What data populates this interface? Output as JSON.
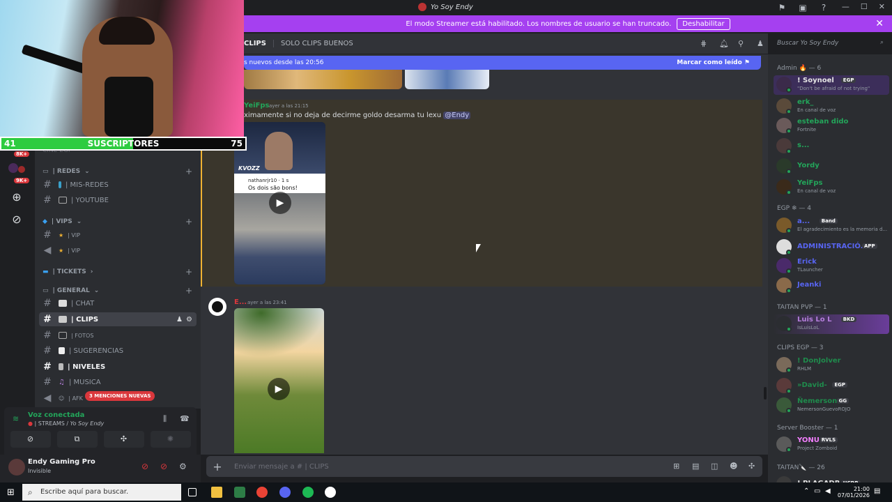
{
  "app": {
    "title": "Yo Soy Endy"
  },
  "banner": {
    "text": "El modo Streamer está habilitado. Los nombres de usuario se han truncado.",
    "button": "Deshabilitar"
  },
  "overlay": {
    "sub_low": "41",
    "sub_label": "SUSCRIPTORES",
    "sub_high": "75",
    "progress_fraction": 0.54
  },
  "rail": {
    "badges": [
      "8K+",
      "9K+"
    ]
  },
  "channels": {
    "partial_top": "CINE EGP",
    "categories": {
      "redes": "| REDES",
      "vips": "| VIPS",
      "tickets": "| TICKETS",
      "general": "| GENERAL"
    },
    "items": {
      "mis_redes": "| MIS-REDES",
      "youtube": "| YOUTUBE",
      "vip1": "| VIP",
      "vip2": "| VIP",
      "chat": "| CHAT",
      "clips": "| CLIPS",
      "fotos": "| FOTOS",
      "sugerencias": "| SUGERENCIAS",
      "niveles": "| NIVELES",
      "musica": "| MUSICA",
      "afk": "| AFK"
    },
    "mentions": "3 MENCIONES NUEVAS"
  },
  "voice": {
    "title": "Voz conectada",
    "channel_prefix": "| STREAMS /",
    "server": "Yo Soy Endy"
  },
  "user": {
    "name": "Endy Gaming Pro",
    "status": "Invisible"
  },
  "header": {
    "channel": "CLIPS",
    "topic": "SOLO CLIPS BUENOS",
    "search_placeholder": "Buscar Yo Soy Endy"
  },
  "newbar": {
    "text": "s nuevos desde las 20:56",
    "mark": "Marcar como leído"
  },
  "messages": [
    {
      "author": "YeiFps",
      "time": "ayer a las 21:15",
      "text": "ximamente si no deja de decirme goldo desarma tu lexu",
      "mention": "@Endy"
    },
    {
      "author": "E...",
      "time": "ayer a las 23:41"
    }
  ],
  "video1": {
    "watermark": "KVOZZ",
    "username": "nathanrjr10 · 1 s",
    "caption": "Os dois são bons!"
  },
  "composer": {
    "placeholder": "Enviar mensaje a #",
    "channel": "| CLIPS"
  },
  "members": {
    "roles": {
      "admin": "Admin 🔥 — 6",
      "egp": "EGP ❄ — 4",
      "taitan_pvp": "TAITAN PVP — 1",
      "clips_egp": "CLIPS EGP — 3",
      "booster": "Server Booster — 1",
      "taitan": "TAITAN🔪 — 26"
    },
    "list": [
      {
        "name": "! Soynoel",
        "tag": "EGP",
        "activity": "\"Don't be afraid of not trying\"",
        "color": "#e6e6e6"
      },
      {
        "name": "erk_",
        "tag": "",
        "activity": "En canal de voz",
        "color": "#23a55a"
      },
      {
        "name": "esteban dido",
        "tag": "",
        "activity": "Fortnite",
        "color": "#23a55a"
      },
      {
        "name": "s...",
        "tag": "",
        "activity": "",
        "color": "#23a55a"
      },
      {
        "name": "Yordy",
        "tag": "",
        "activity": "",
        "color": "#23a55a"
      },
      {
        "name": "YeiFps",
        "tag": "",
        "activity": "En canal de voz",
        "color": "#23a55a"
      },
      {
        "name": "a...",
        "tag": "Band",
        "activity": "El agradecimiento es la memoria d...",
        "color": "#5865f2"
      },
      {
        "name": "ADMINISTRACIÓ...",
        "tag": "APP",
        "activity": "",
        "color": "#5865f2"
      },
      {
        "name": "Erick",
        "tag": "",
        "activity": "TLauncher",
        "color": "#5865f2"
      },
      {
        "name": "Jeanki",
        "tag": "",
        "activity": "",
        "color": "#5865f2"
      },
      {
        "name": "Luis Lo L",
        "tag": "BKD",
        "activity": "IsLuisLoL",
        "color": "#b57edc"
      },
      {
        "name": "! DonJolver",
        "tag": "",
        "activity": "RHLM",
        "color": "#1f8b4c"
      },
      {
        "name": "»David-",
        "tag": "EGP",
        "activity": "",
        "color": "#1f8b4c"
      },
      {
        "name": "Ñemerson",
        "tag": "GG",
        "activity": "NemersonGuevoROJO",
        "color": "#1f8b4c"
      },
      {
        "name": "YONU",
        "tag": "RVLS",
        "activity": "Project Zomboid",
        "color": "#f47fff"
      },
      {
        "name": "! PLAGADR",
        "tag": "UCDR",
        "activity": "",
        "color": "#e6e6e6"
      }
    ]
  },
  "taskbar": {
    "search": "Escribe aquí para buscar.",
    "time": "21:00",
    "date": "07/01/2026"
  },
  "colors": {
    "accent": "#5865f2",
    "banner": "#a540f0",
    "online": "#23a55a",
    "mention": "#da373c"
  }
}
